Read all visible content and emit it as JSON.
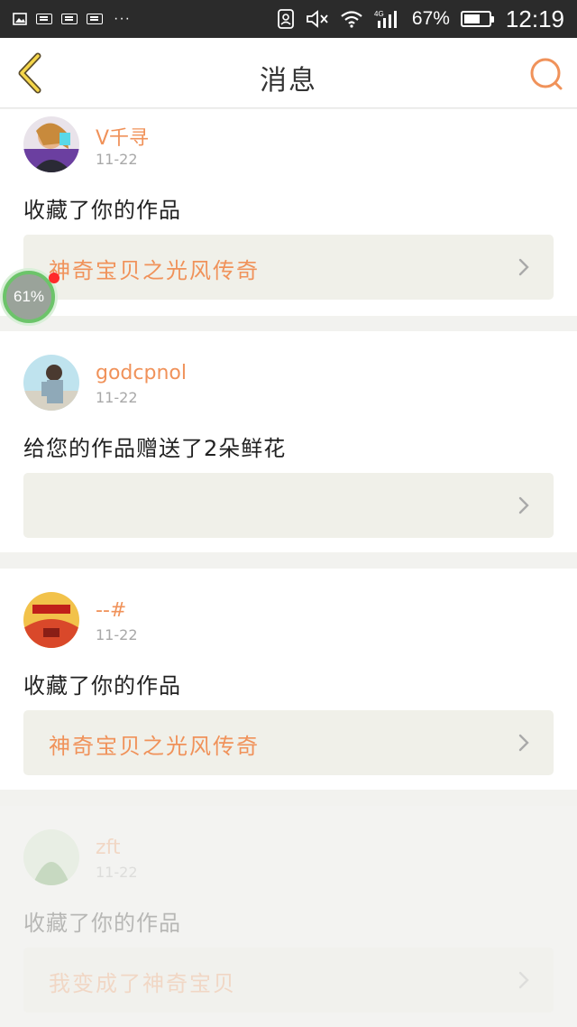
{
  "status_bar": {
    "battery_percent": "67%",
    "battery_level": 0.67,
    "time": "12:19",
    "network": "4G",
    "overflow": "···"
  },
  "header": {
    "title": "消息",
    "back_icon": "chevron-left-icon",
    "search_icon": "search-icon"
  },
  "float_widget": {
    "label": "61%"
  },
  "colors": {
    "accent": "#f0925a",
    "card_bg": "#ffffff",
    "work_bg": "#f0f0e9",
    "page_bg": "#f2f2ef"
  },
  "messages": [
    {
      "username": "V千寻",
      "date": "11-22",
      "action": "收藏了你的作品",
      "work_title": "神奇宝贝之光风传奇"
    },
    {
      "username": "godcpnol",
      "date": "11-22",
      "action": "给您的作品赠送了2朵鲜花",
      "work_title": ""
    },
    {
      "username": "--#",
      "date": "11-22",
      "action": "收藏了你的作品",
      "work_title": "神奇宝贝之光风传奇"
    },
    {
      "username": "zft",
      "date": "11-22",
      "action": "收藏了你的作品",
      "work_title": "我变成了神奇宝贝"
    }
  ]
}
